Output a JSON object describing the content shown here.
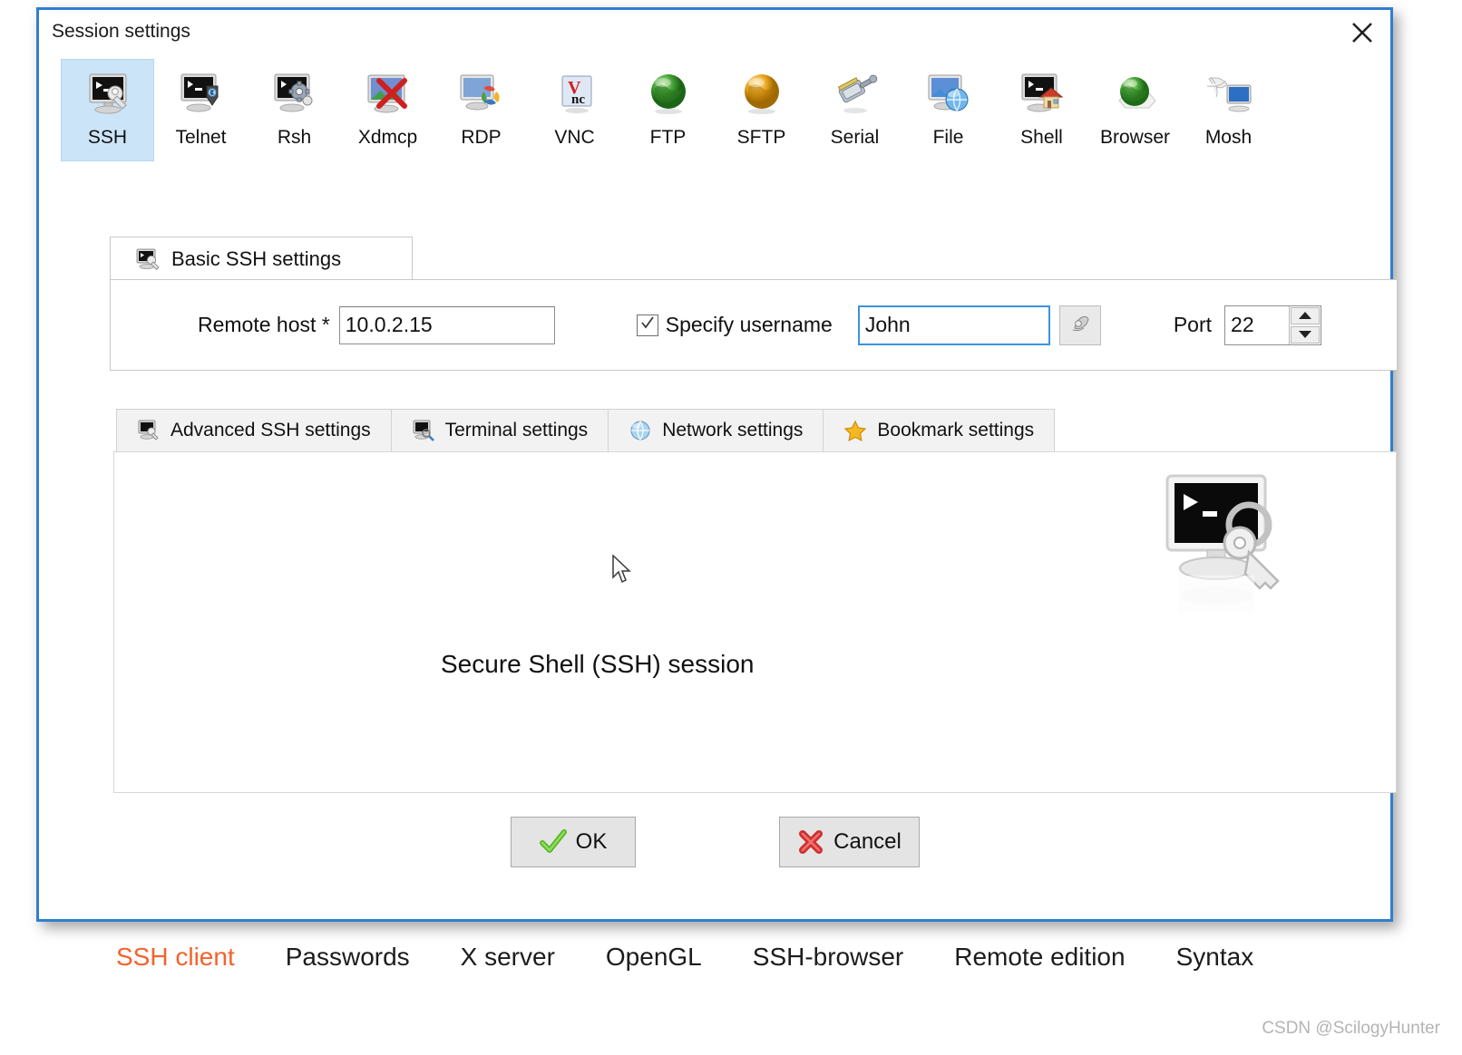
{
  "window": {
    "title": "Session settings",
    "close_icon": "close-icon",
    "border_color": "#2f7fd1"
  },
  "protocols": [
    {
      "label": "SSH",
      "icon": "ssh-icon",
      "selected": true
    },
    {
      "label": "Telnet",
      "icon": "telnet-icon",
      "selected": false
    },
    {
      "label": "Rsh",
      "icon": "rsh-icon",
      "selected": false
    },
    {
      "label": "Xdmcp",
      "icon": "xdmcp-icon",
      "selected": false
    },
    {
      "label": "RDP",
      "icon": "rdp-icon",
      "selected": false
    },
    {
      "label": "VNC",
      "icon": "vnc-icon",
      "selected": false
    },
    {
      "label": "FTP",
      "icon": "ftp-icon",
      "selected": false
    },
    {
      "label": "SFTP",
      "icon": "sftp-icon",
      "selected": false
    },
    {
      "label": "Serial",
      "icon": "serial-icon",
      "selected": false
    },
    {
      "label": "File",
      "icon": "file-icon",
      "selected": false
    },
    {
      "label": "Shell",
      "icon": "shell-icon",
      "selected": false
    },
    {
      "label": "Browser",
      "icon": "browser-icon",
      "selected": false
    },
    {
      "label": "Mosh",
      "icon": "mosh-icon",
      "selected": false
    }
  ],
  "basic_settings": {
    "tab_label": "Basic SSH settings",
    "tab_icon": "ssh-icon",
    "remote_host": {
      "label": "Remote host *",
      "value": "10.0.2.15",
      "placeholder": ""
    },
    "specify_username": {
      "label": "Specify username",
      "checked": true,
      "value": "John",
      "placeholder": "",
      "focused": true,
      "browse_icon": "user-browse-icon"
    },
    "port": {
      "label": "Port",
      "value": "22",
      "up_icon": "spinner-up-icon",
      "down_icon": "spinner-down-icon"
    }
  },
  "sub_tabs": [
    {
      "label": "Advanced SSH settings",
      "icon": "ssh-icon",
      "active": false
    },
    {
      "label": "Terminal settings",
      "icon": "terminal-icon",
      "active": false
    },
    {
      "label": "Network settings",
      "icon": "globe-icon",
      "active": false
    },
    {
      "label": "Bookmark settings",
      "icon": "star-icon",
      "active": false
    }
  ],
  "content": {
    "caption": "Secure Shell (SSH) session",
    "illustration_icon": "ssh-session-monitor-key-icon",
    "cursor_icon": "mouse-pointer-icon"
  },
  "actions": {
    "ok": {
      "label": "OK",
      "icon": "green-check-icon"
    },
    "cancel": {
      "label": "Cancel",
      "icon": "red-cross-icon"
    }
  },
  "bottom_nav": {
    "active_color": "#f4622c",
    "links": [
      {
        "label": "SSH client",
        "active": true
      },
      {
        "label": "Passwords",
        "active": false
      },
      {
        "label": "X server",
        "active": false
      },
      {
        "label": "OpenGL",
        "active": false
      },
      {
        "label": "SSH-browser",
        "active": false
      },
      {
        "label": "Remote edition",
        "active": false
      },
      {
        "label": "Syntax",
        "active": false
      }
    ]
  },
  "watermark": "CSDN @ScilogyHunter"
}
